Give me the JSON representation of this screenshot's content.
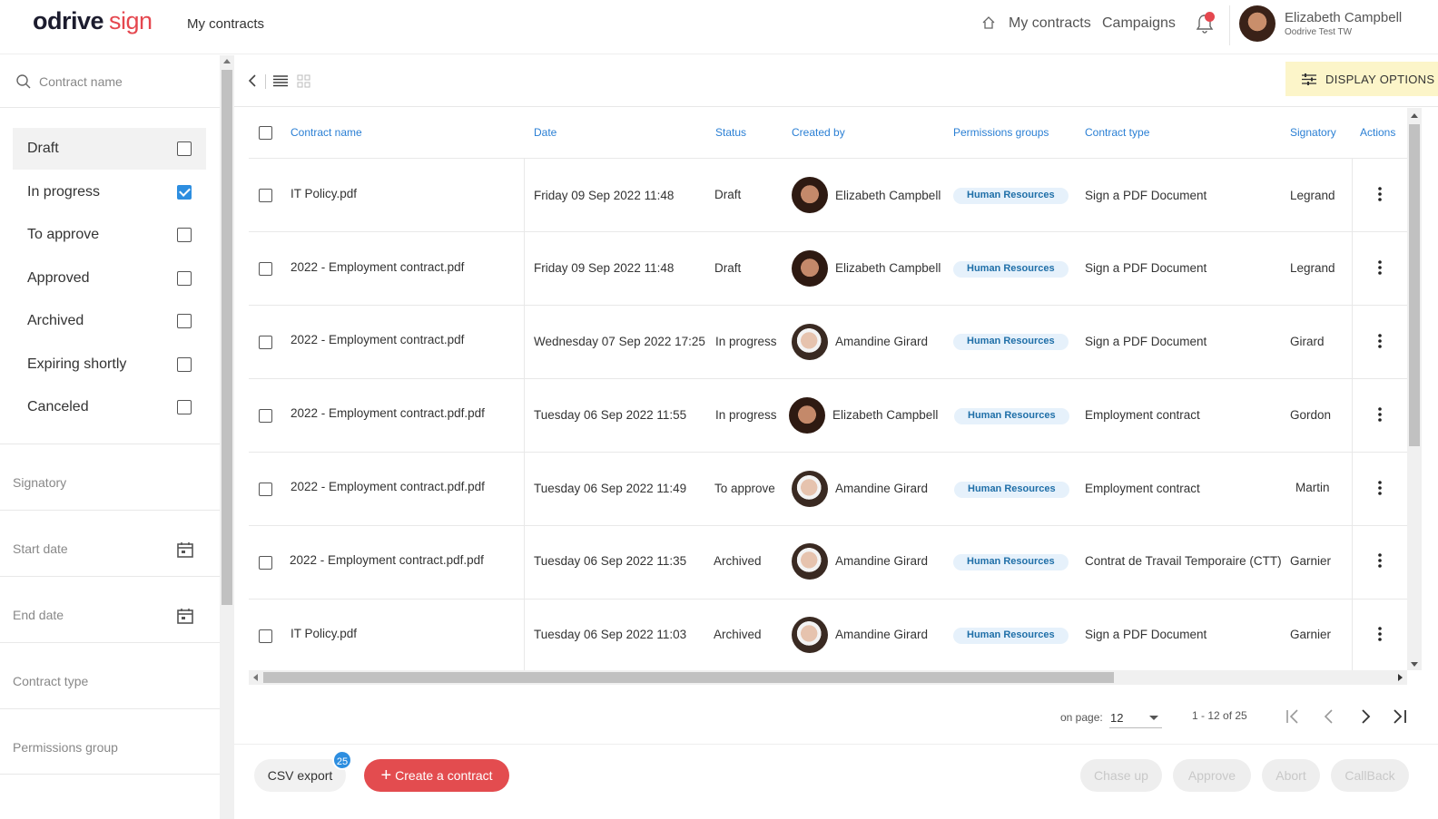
{
  "header": {
    "logo_main": "odrive",
    "logo_sign": "sign",
    "title": "My contracts",
    "nav": [
      {
        "label": "My contracts"
      },
      {
        "label": "Campaigns"
      }
    ],
    "user": {
      "name": "Elizabeth Campbell",
      "org": "Oodrive Test TW"
    }
  },
  "sidebar": {
    "search_placeholder": "Contract name",
    "statuses": [
      {
        "label": "Draft",
        "checked": false
      },
      {
        "label": "In progress",
        "checked": true
      },
      {
        "label": "To approve",
        "checked": false
      },
      {
        "label": "Approved",
        "checked": false
      },
      {
        "label": "Archived",
        "checked": false
      },
      {
        "label": "Expiring shortly",
        "checked": false
      },
      {
        "label": "Canceled",
        "checked": false
      }
    ],
    "filters": {
      "signatory": "Signatory",
      "start_date": "Start date",
      "end_date": "End date",
      "contract_type": "Contract type",
      "permissions_group": "Permissions group"
    }
  },
  "toolbar": {
    "display_options": "DISPLAY OPTIONS"
  },
  "table": {
    "columns": [
      "Contract name",
      "Date",
      "Status",
      "Created by",
      "Permissions groups",
      "Contract type",
      "Signatory",
      "Actions"
    ],
    "rows": [
      {
        "name": "IT Policy.pdf",
        "date": "Friday 09 Sep 2022 11:48",
        "status": "Draft",
        "creator": "Elizabeth Campbell",
        "group": "Human Resources",
        "type": "Sign a PDF Document",
        "signatory": "Legrand"
      },
      {
        "name": "2022 - Employment contract.pdf",
        "date": "Friday 09 Sep 2022 11:48",
        "status": "Draft",
        "creator": "Elizabeth Campbell",
        "group": "Human Resources",
        "type": "Sign a PDF Document",
        "signatory": "Legrand"
      },
      {
        "name": "2022 - Employment contract.pdf",
        "date": "Wednesday 07 Sep 2022 17:25",
        "status": "In progress",
        "creator": "Amandine Girard",
        "group": "Human Resources",
        "type": "Sign a PDF Document",
        "signatory": "Girard"
      },
      {
        "name": "2022 - Employment contract.pdf.pdf",
        "date": "Tuesday 06 Sep 2022 11:55",
        "status": "In progress",
        "creator": "Elizabeth Campbell",
        "group": "Human Resources",
        "type": "Employment contract",
        "signatory": "Gordon"
      },
      {
        "name": "2022 - Employment contract.pdf.pdf",
        "date": "Tuesday 06 Sep 2022 11:49",
        "status": "To approve",
        "creator": "Amandine Girard",
        "group": "Human Resources",
        "type": "Employment contract",
        "signatory": "Martin"
      },
      {
        "name": "2022 - Employment contract.pdf.pdf",
        "date": "Tuesday 06 Sep 2022 11:35",
        "status": "Archived",
        "creator": "Amandine Girard",
        "group": "Human Resources",
        "type": "Contrat de Travail Temporaire (CTT)",
        "signatory": "Garnier"
      },
      {
        "name": "IT Policy.pdf",
        "date": "Tuesday 06 Sep 2022 11:03",
        "status": "Archived",
        "creator": "Amandine Girard",
        "group": "Human Resources",
        "type": "Sign a PDF Document",
        "signatory": "Garnier"
      }
    ]
  },
  "pagination": {
    "label": "on page:",
    "per_page": "12",
    "range": "1 - 12 of 25"
  },
  "footer": {
    "csv_export": "CSV export",
    "csv_count": "25",
    "create": "Create a contract",
    "chase_up": "Chase up",
    "approve": "Approve",
    "abort": "Abort",
    "callback": "CallBack"
  },
  "colors": {
    "accent": "#2a7fd4",
    "brand_red": "#e34c4f",
    "badge_bg": "#e6f1fb",
    "highlight": "#fcf5c9"
  }
}
